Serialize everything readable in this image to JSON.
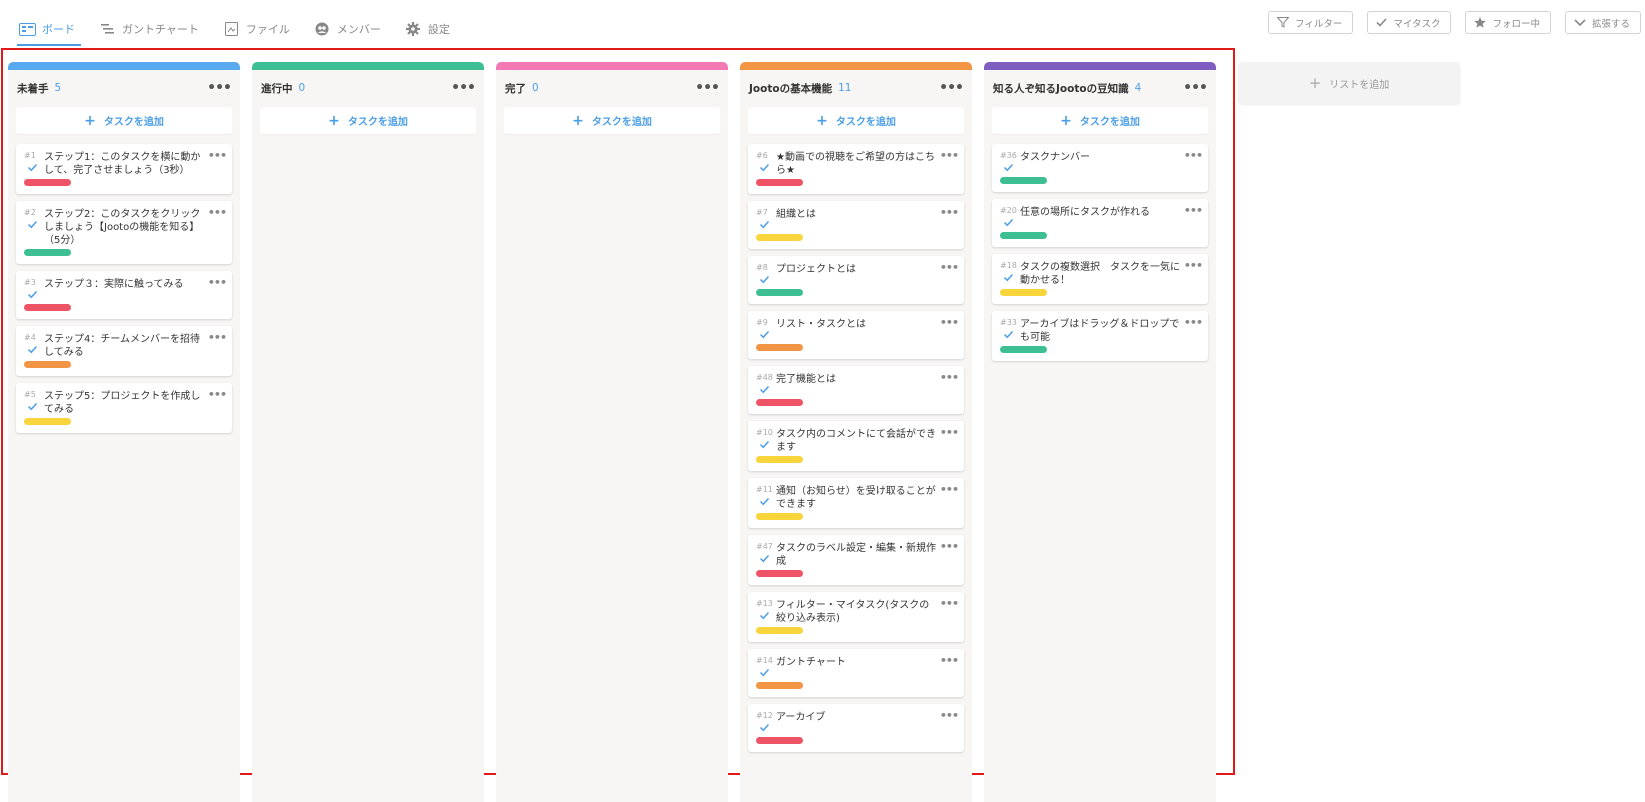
{
  "tabs": [
    {
      "label": "ボード",
      "icon": "board-icon",
      "active": true
    },
    {
      "label": "ガントチャート",
      "icon": "gantt-icon",
      "active": false
    },
    {
      "label": "ファイル",
      "icon": "file-icon",
      "active": false
    },
    {
      "label": "メンバー",
      "icon": "members-icon",
      "active": false
    },
    {
      "label": "設定",
      "icon": "gear-icon",
      "active": false
    }
  ],
  "actions": [
    {
      "label": "フィルター",
      "icon": "filter-icon"
    },
    {
      "label": "マイタスク",
      "icon": "check-icon"
    },
    {
      "label": "フォロー中",
      "icon": "star-icon"
    },
    {
      "label": "拡張する",
      "icon": "chevron-down-icon"
    }
  ],
  "add_task_label": "タスクを追加",
  "add_list_label": "リストを追加",
  "colors": {
    "accent": "#4a9ee8",
    "frame": "#e01919",
    "red": "#ee5465",
    "green": "#3dbf93",
    "orange": "#f29544",
    "yellow": "#f8d53d"
  },
  "lists": [
    {
      "title": "未着手",
      "count": "5",
      "color": "#58a9ef",
      "cards": [
        {
          "num": "#1",
          "title": "ステップ1：このタスクを横に動かして、完了させましょう（3秒）",
          "label": "red"
        },
        {
          "num": "#2",
          "title": "ステップ2：このタスクをクリックしましょう【Jootoの機能を知る】（5分）",
          "label": "green"
        },
        {
          "num": "#3",
          "title": "ステップ３：実際に触ってみる",
          "label": "red"
        },
        {
          "num": "#4",
          "title": "ステップ4：チームメンバーを招待してみる",
          "label": "orange"
        },
        {
          "num": "#5",
          "title": "ステップ5：プロジェクトを作成してみる",
          "label": "yellow"
        }
      ]
    },
    {
      "title": "進行中",
      "count": "0",
      "color": "#3dbf93",
      "cards": []
    },
    {
      "title": "完了",
      "count": "0",
      "color": "#f279b4",
      "cards": []
    },
    {
      "title": "Jootoの基本機能",
      "count": "11",
      "color": "#f29544",
      "cards": [
        {
          "num": "#6",
          "title": "★動画での視聴をご希望の方はこちら★",
          "label": "red"
        },
        {
          "num": "#7",
          "title": "組織とは",
          "label": "yellow"
        },
        {
          "num": "#8",
          "title": "プロジェクトとは",
          "label": "green"
        },
        {
          "num": "#9",
          "title": "リスト・タスクとは",
          "label": "orange"
        },
        {
          "num": "#48",
          "title": "完了機能とは",
          "label": "red"
        },
        {
          "num": "#10",
          "title": "タスク内のコメントにて会話ができます",
          "label": "yellow"
        },
        {
          "num": "#11",
          "title": "通知（お知らせ）を受け取ることができます",
          "label": "yellow"
        },
        {
          "num": "#47",
          "title": "タスクのラベル設定・編集・新規作成",
          "label": "red"
        },
        {
          "num": "#13",
          "title": "フィルター・マイタスク(タスクの絞り込み表示)",
          "label": "yellow"
        },
        {
          "num": "#14",
          "title": "ガントチャート",
          "label": "orange"
        },
        {
          "num": "#12",
          "title": "アーカイブ",
          "label": "red"
        }
      ]
    },
    {
      "title": "知る人ぞ知るJootoの豆知識",
      "count": "4",
      "color": "#7e5cc0",
      "cards": [
        {
          "num": "#36",
          "title": "タスクナンバー",
          "label": "green"
        },
        {
          "num": "#20",
          "title": "任意の場所にタスクが作れる",
          "label": "green"
        },
        {
          "num": "#18",
          "title": "タスクの複数選択　タスクを一気に動かせる！",
          "label": "yellow"
        },
        {
          "num": "#33",
          "title": "アーカイブはドラッグ＆ドロップでも可能",
          "label": "green"
        }
      ]
    }
  ]
}
